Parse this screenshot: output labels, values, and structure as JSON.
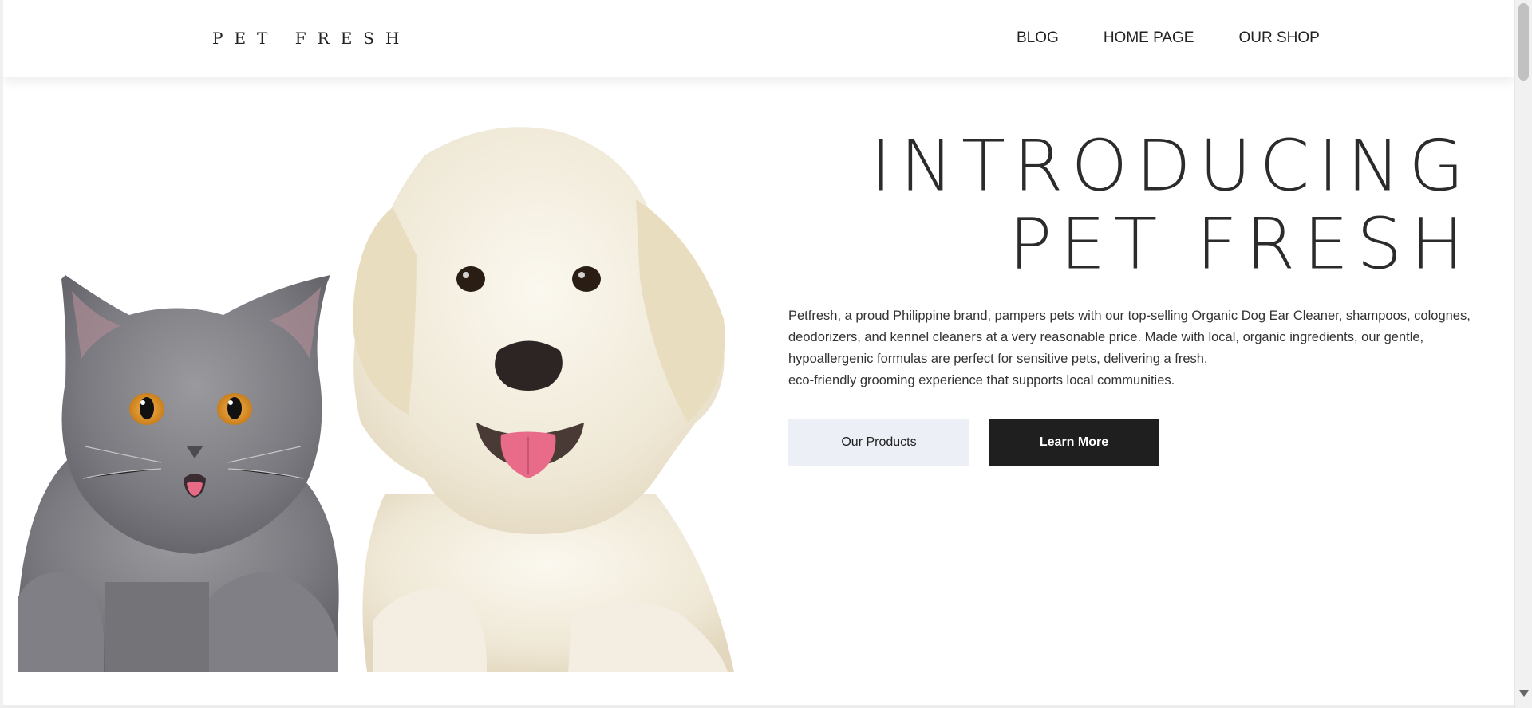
{
  "header": {
    "logo": "PET FRESH",
    "nav": [
      "BLOG",
      "HOME PAGE",
      "OUR SHOP"
    ]
  },
  "hero": {
    "title_line1": "INTRODUCING",
    "title_line2": "PET FRESH",
    "description": [
      "Petfresh, a proud  Philippine brand, pampers pets with our top-selling Organic  Dog  Ear Cleaner, shampoos, colognes,",
      "deodorizers, and kennel cleaners at a very reasonable price.  Made with local, organic ingredients, our gentle,",
      "hypoallergenic formulas are perfect for sensitive pets, delivering a fresh,",
      "eco-friendly grooming experience that supports local communities."
    ],
    "buttons": {
      "products": "Our Products",
      "learn_more": "Learn More"
    }
  },
  "colors": {
    "accent_dark": "#1f1f1f",
    "accent_light": "#eceff5"
  }
}
